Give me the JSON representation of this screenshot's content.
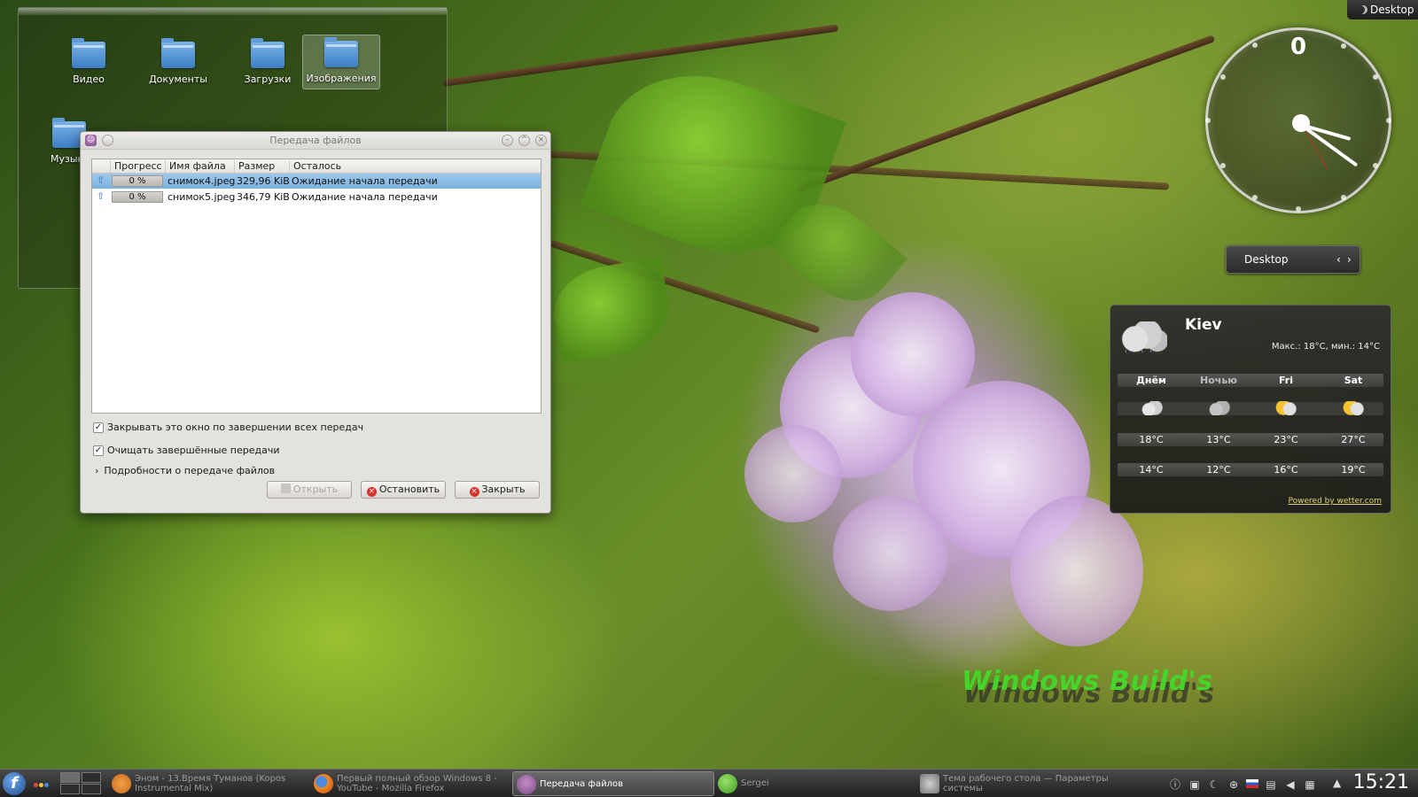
{
  "desktop": {
    "top_right_label": "Desktop",
    "watermark": "Windows Build's",
    "folders": [
      {
        "label": "Видео",
        "selected": false
      },
      {
        "label": "Документы",
        "selected": false
      },
      {
        "label": "Загрузки",
        "selected": false
      },
      {
        "label": "Изображения",
        "selected": true
      },
      {
        "label": "Музыка",
        "selected": false
      }
    ]
  },
  "dialog": {
    "title": "Передача файлов",
    "columns": [
      "Прогресс",
      "Имя файла",
      "Размер",
      "Осталось"
    ],
    "rows": [
      {
        "progress": "0 %",
        "progress_value": 0,
        "filename": "снимок4.jpeg",
        "size": "329,96 KiB",
        "remaining": "Ожидание начала передачи",
        "selected": true
      },
      {
        "progress": "0 %",
        "progress_value": 0,
        "filename": "снимок5.jpeg",
        "size": "346,79 KiB",
        "remaining": "Ожидание начала передачи",
        "selected": false
      }
    ],
    "close_on_finish_label": "Закрывать это окно по завершении всех передач",
    "close_on_finish_checked": true,
    "clear_finished_label": "Очищать завершённые передачи",
    "clear_finished_checked": true,
    "details_label": "Подробности о передаче файлов",
    "buttons": {
      "open": "Открыть",
      "stop": "Остановить",
      "close": "Закрыть"
    }
  },
  "clock_widget": {
    "numeral": "0"
  },
  "pager": {
    "label": "Desktop"
  },
  "weather": {
    "city": "Kiev",
    "range": "Макс.: 18°C, мин.: 14°C",
    "current_icon": "rain-cloud-icon",
    "days": [
      {
        "name": "Днём",
        "icon": "cloudy-icon",
        "high": "18°C",
        "low": "14°C",
        "dim": false
      },
      {
        "name": "Ночью",
        "icon": "cloudy-icon",
        "high": "13°C",
        "low": "12°C",
        "dim": true
      },
      {
        "name": "Fri",
        "icon": "partly-sunny-icon",
        "high": "23°C",
        "low": "16°C",
        "dim": false
      },
      {
        "name": "Sat",
        "icon": "partly-sunny-icon",
        "high": "27°C",
        "low": "19°C",
        "dim": false
      }
    ],
    "powered_by": "Powered by wetter.com"
  },
  "taskbar": {
    "tasks": [
      {
        "label": "Эном - 13.Время Туманов (Kopos Instrumental Mix)",
        "icon": "music-player-icon",
        "active": false
      },
      {
        "label": "Первый полный обзор Windows 8 - YouTube - Mozilla Firefox",
        "icon": "firefox-icon",
        "active": false
      },
      {
        "label": "Передача файлов",
        "icon": "file-transfer-icon",
        "active": true
      },
      {
        "label": "Sergei",
        "icon": "chat-icon",
        "active": false
      },
      {
        "label": "Тема рабочего стола — Параметры системы",
        "icon": "settings-icon",
        "active": false
      }
    ],
    "time": "15:21",
    "colors": {
      "accent": "#3a7bc8",
      "taskbar": "#2a2a2a"
    }
  }
}
